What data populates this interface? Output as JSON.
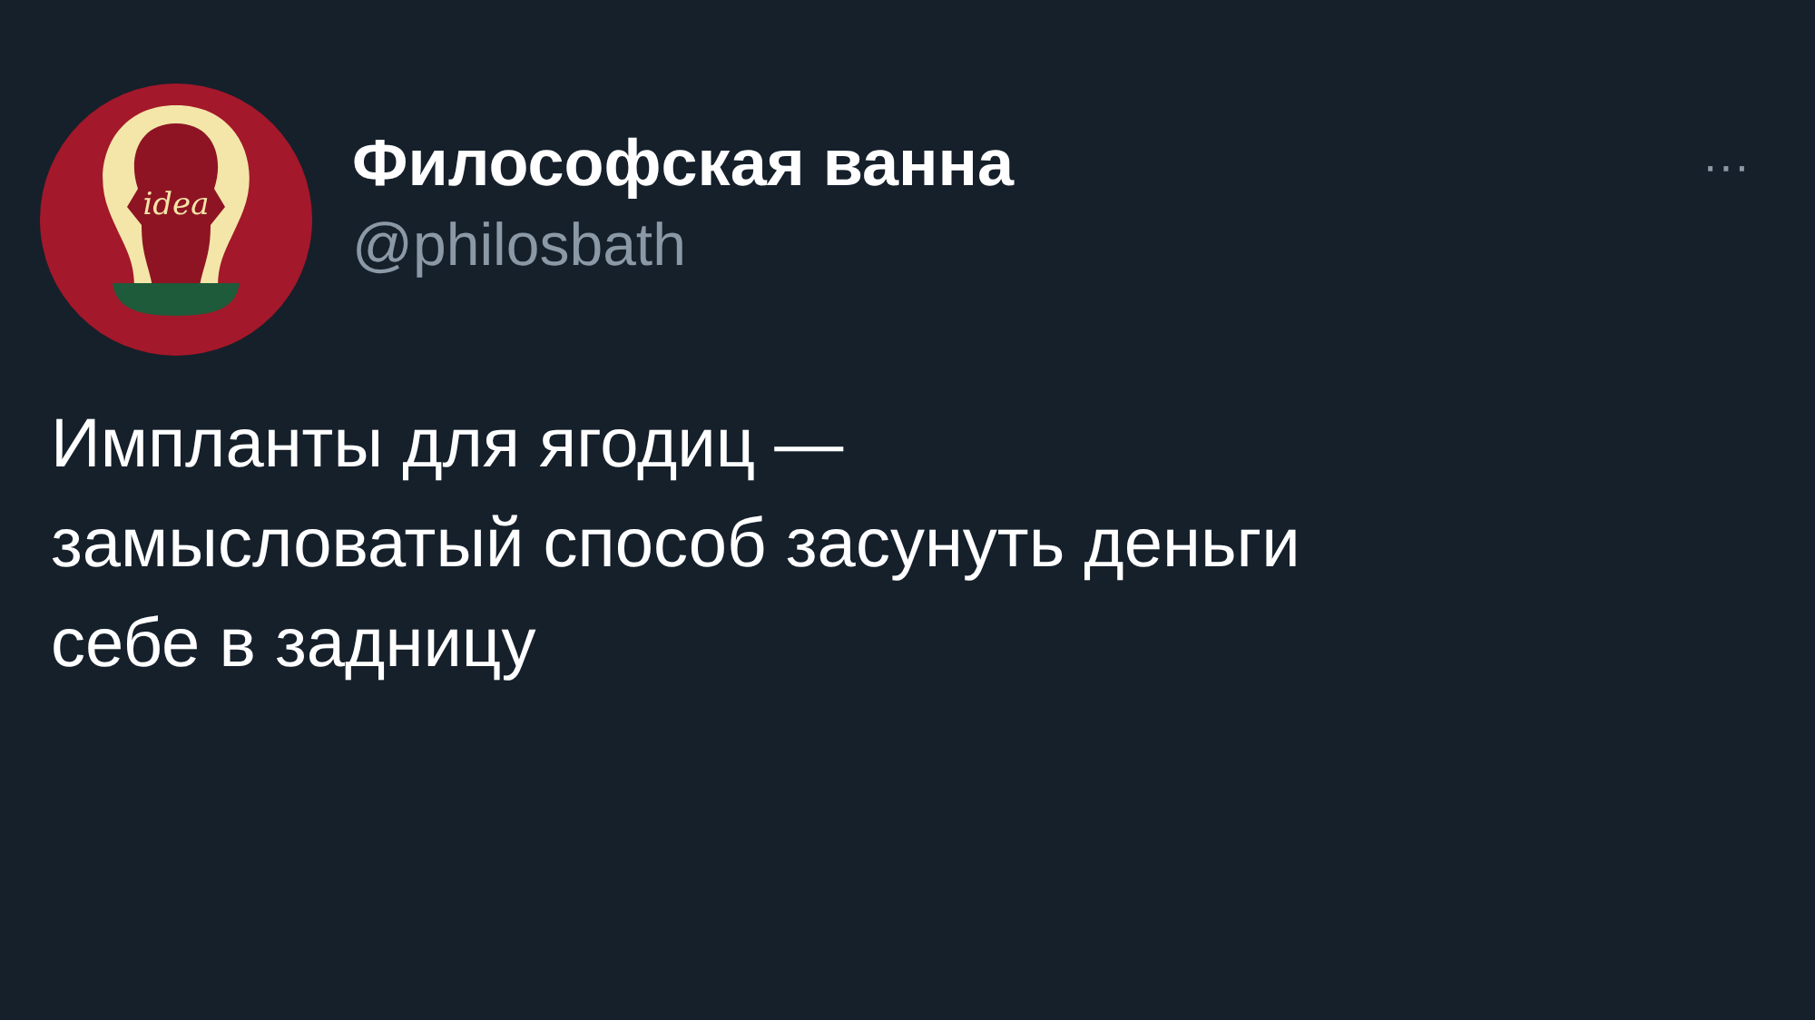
{
  "tweet": {
    "avatar": {
      "text": "idea"
    },
    "name": "Философская ванна",
    "handle": "@philosbath",
    "more": "···",
    "text_lines": [
      "Импланты для ягодиц —",
      "замысловатый способ засунуть деньги",
      "себе в задницу"
    ]
  }
}
